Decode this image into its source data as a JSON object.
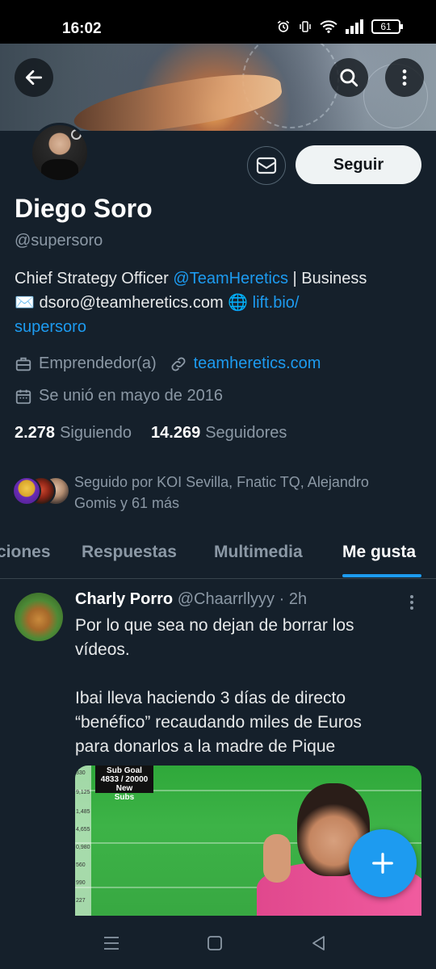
{
  "status_bar": {
    "time": "16:02",
    "battery": "61"
  },
  "profile": {
    "name": "Diego Soro",
    "handle": "@supersoro",
    "follow_label": "Seguir",
    "bio": {
      "part1": "Chief Strategy Officer ",
      "mention": "@TeamHeretics",
      "part2": " | Business",
      "line2_prefix": "✉️ dsoro@teamheretics.com ",
      "link_icon": "🌐",
      "link": " lift.bio/",
      "link_line2": "supersoro"
    },
    "category": "Emprendedor(a)",
    "website": "teamheretics.com",
    "joined": "Se unió en mayo de 2016",
    "following_count": "2.278",
    "following_label": "Siguiendo",
    "followers_count": "14.269",
    "followers_label": "Seguidores",
    "followed_by": "Seguido por KOI Sevilla, Fnatic TQ, Alejandro Gomis y 61 más"
  },
  "tabs": [
    {
      "label": "ciones",
      "active": false
    },
    {
      "label": "Respuestas",
      "active": false
    },
    {
      "label": "Multimedia",
      "active": false
    },
    {
      "label": "Me gusta",
      "active": true
    }
  ],
  "tweet": {
    "author_name": "Charly Porro",
    "author_handle": "@Chaarrllyyy",
    "separator": " · ",
    "time": "2h",
    "lines": [
      "Por lo que sea no dejan de borrar los",
      "vídeos.",
      "",
      " Ibai lleva haciendo 3 días de directo",
      "“benéfico” recaudando miles de Euros",
      "para donarlos a la madre de Pique"
    ],
    "image": {
      "counter_top": "Sub Goal",
      "counter_value": "4833 / 20000",
      "counter_label1": "New",
      "counter_label2": "Subs",
      "scale_labels": [
        "330",
        "9,125",
        "1,485",
        "4,655",
        "0,980",
        "560",
        "990",
        "227"
      ]
    }
  },
  "colors": {
    "background": "#15202b",
    "accent": "#1d9bf0",
    "secondary_text": "#8b98a5"
  },
  "icons": [
    "back-arrow-icon",
    "search-icon",
    "more-vertical-icon",
    "mail-icon",
    "briefcase-icon",
    "link-icon",
    "calendar-icon",
    "compose-plus-icon"
  ]
}
